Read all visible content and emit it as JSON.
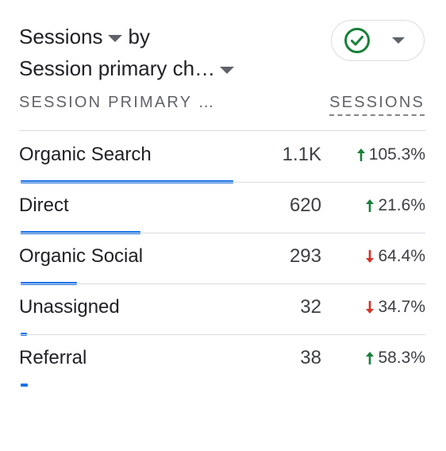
{
  "title": {
    "metric": "Sessions",
    "connector": "by",
    "dimension": "Session primary ch…"
  },
  "table": {
    "dimension_header": "SESSION PRIMARY …",
    "metric_header": "SESSIONS",
    "max_value": 1100,
    "rows": [
      {
        "label": "Organic Search",
        "value": "1.1K",
        "numeric": 1100,
        "change": "105.3%",
        "direction": "up"
      },
      {
        "label": "Direct",
        "value": "620",
        "numeric": 620,
        "change": "21.6%",
        "direction": "up"
      },
      {
        "label": "Organic Social",
        "value": "293",
        "numeric": 293,
        "change": "64.4%",
        "direction": "down"
      },
      {
        "label": "Unassigned",
        "value": "32",
        "numeric": 32,
        "change": "34.7%",
        "direction": "down"
      },
      {
        "label": "Referral",
        "value": "38",
        "numeric": 38,
        "change": "58.3%",
        "direction": "up"
      }
    ]
  },
  "icons": {
    "status": "check-circle-icon",
    "up": "arrow-up-icon",
    "down": "arrow-down-icon"
  },
  "colors": {
    "bar": "#1a73e8",
    "up": "#188038",
    "down": "#d93025",
    "check": "#188038"
  }
}
